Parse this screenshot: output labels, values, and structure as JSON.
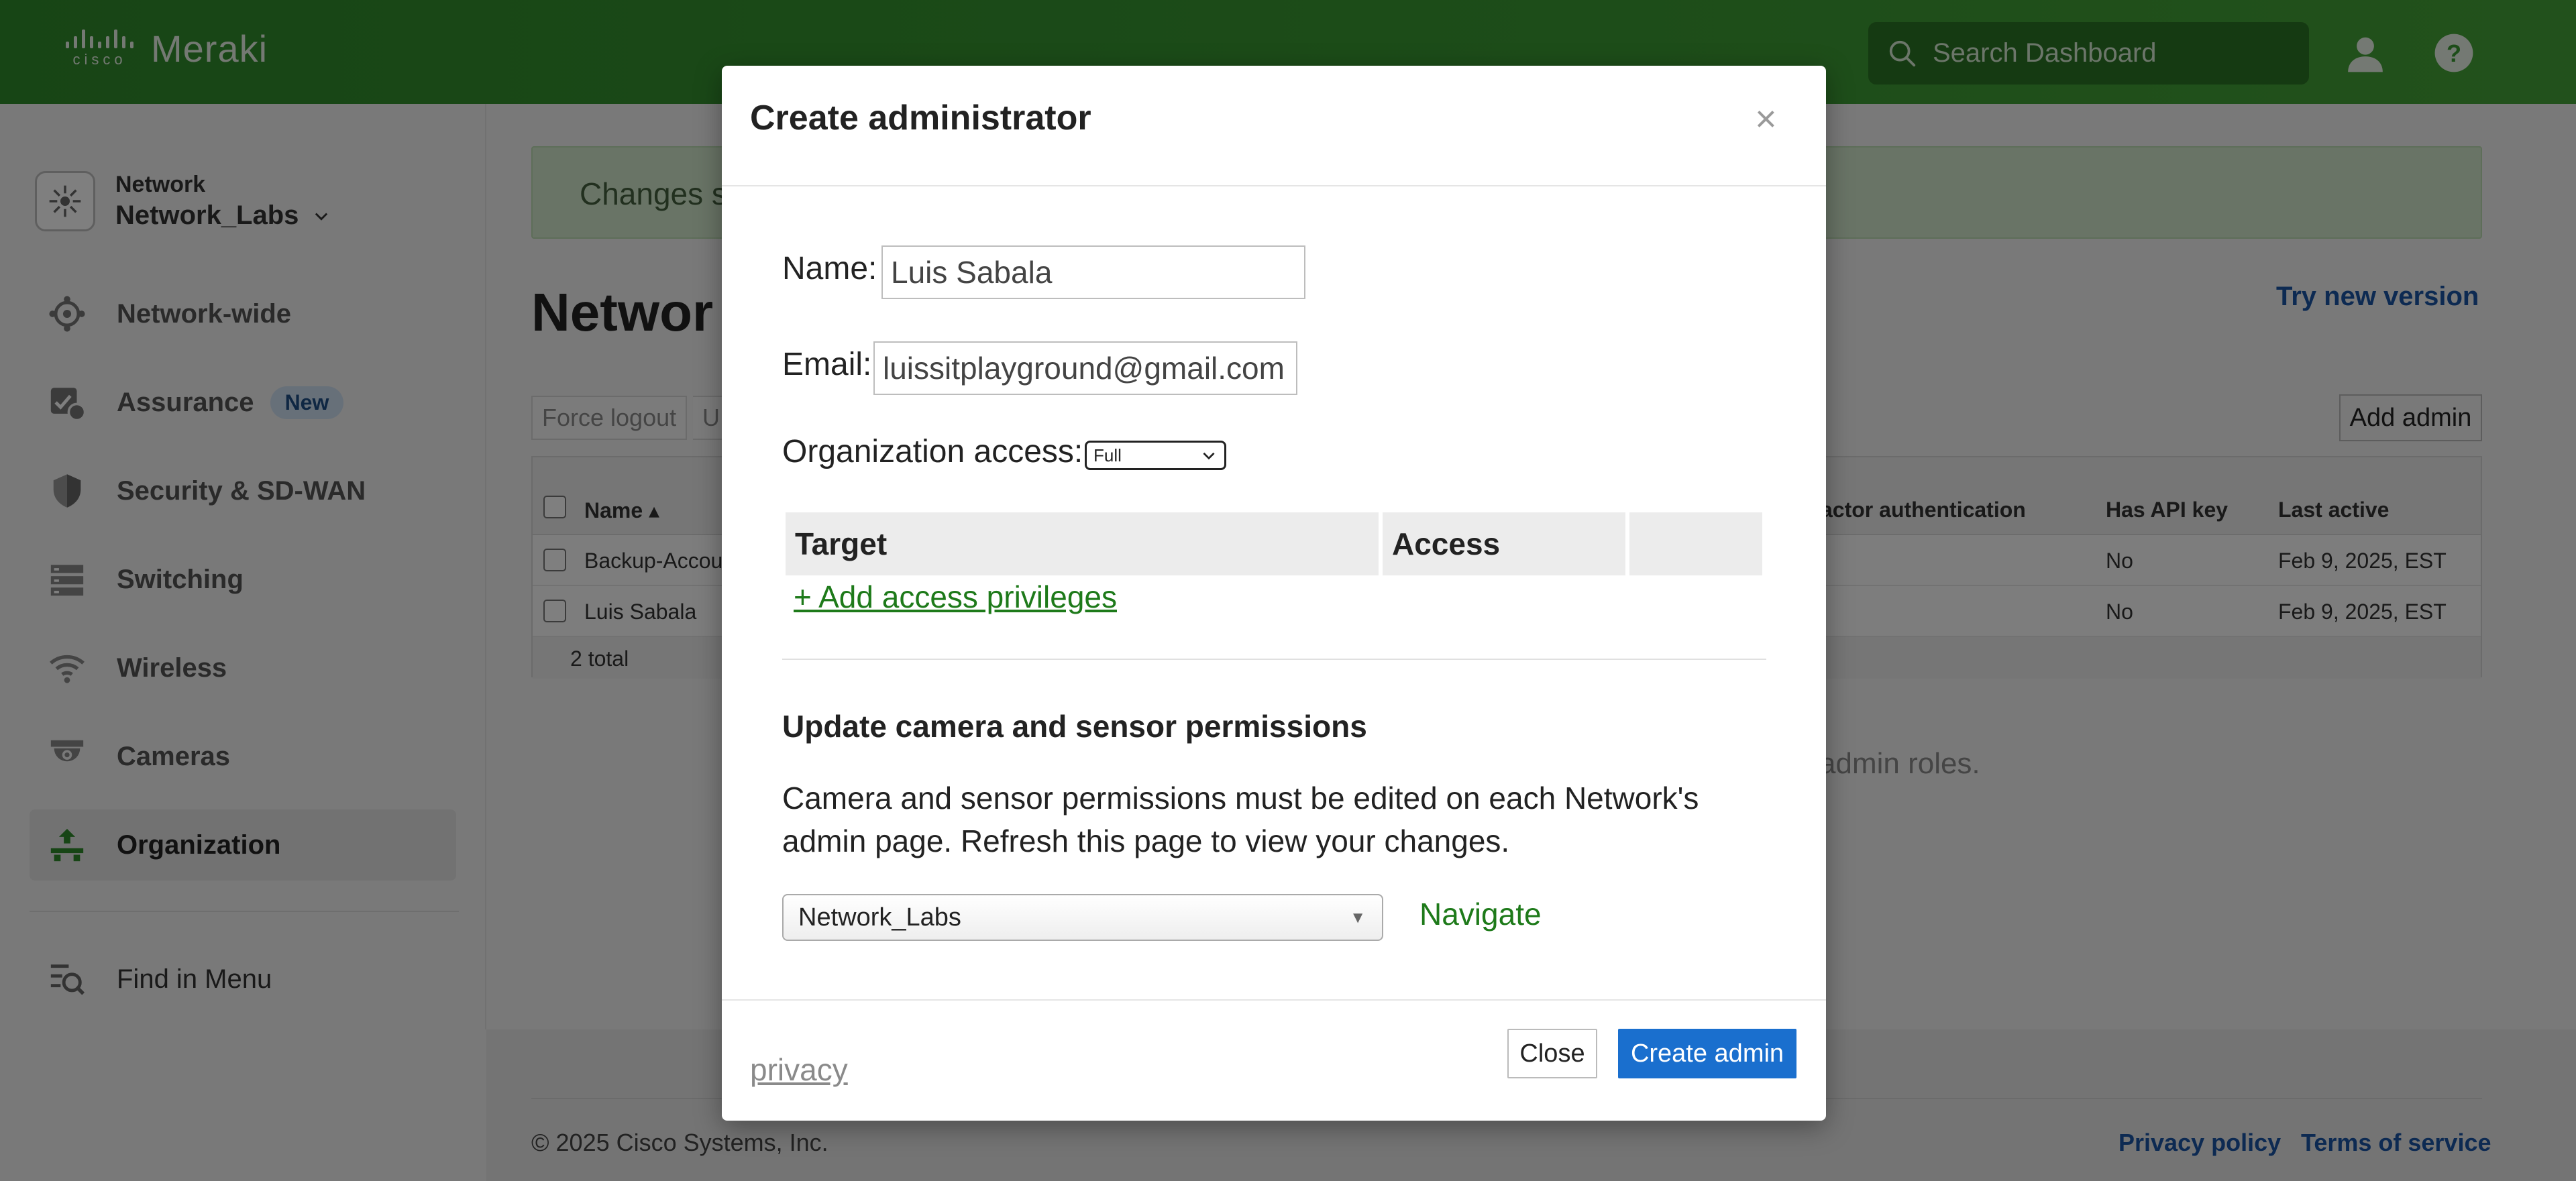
{
  "app": {
    "brand_small": "cisco",
    "brand_name": "Meraki",
    "search_placeholder": "Search Dashboard"
  },
  "sidebar": {
    "network_label": "Network",
    "network_name": "Network_Labs",
    "items": [
      {
        "label": "Network-wide",
        "icon": "network-wide-icon"
      },
      {
        "label": "Assurance",
        "icon": "assurance-icon",
        "badge": "New"
      },
      {
        "label": "Security & SD-WAN",
        "icon": "shield-icon"
      },
      {
        "label": "Switching",
        "icon": "switch-icon"
      },
      {
        "label": "Wireless",
        "icon": "wifi-icon"
      },
      {
        "label": "Cameras",
        "icon": "camera-icon"
      },
      {
        "label": "Organization",
        "icon": "organization-icon",
        "active": true
      }
    ],
    "find_in_menu": "Find in Menu"
  },
  "main": {
    "banner_text": "Changes s",
    "title_partial": "Networ",
    "try_new_version": "Try new version",
    "toolbar": {
      "force_logout": "Force logout",
      "next_partial": "U",
      "add_admin": "Add admin"
    },
    "table": {
      "columns": [
        "Name ▴",
        "actor authentication",
        "Has API key",
        "Last active"
      ],
      "rows": [
        {
          "name": "Backup-Accou",
          "api": "No",
          "last_active": "Feb 9, 2025, EST"
        },
        {
          "name": "Luis Sabala",
          "api": "No",
          "last_active": "Feb 9, 2025, EST"
        }
      ],
      "total": "2 total"
    },
    "admin_roles_partial": "admin roles."
  },
  "footer": {
    "copyright": "© 2025 Cisco Systems, Inc.",
    "privacy_policy": "Privacy policy",
    "terms": "Terms of service"
  },
  "modal": {
    "title": "Create administrator",
    "close_x": "×",
    "name_label": "Name:",
    "name_value": "Luis Sabala",
    "email_label": "Email:",
    "email_value": "luissitplayground@gmail.com",
    "org_access_label": "Organization access:",
    "org_access_value": "Full",
    "privileges_table": {
      "target_header": "Target",
      "access_header": "Access",
      "add_link": "+ Add access privileges"
    },
    "camera_section_title": "Update camera and sensor permissions",
    "camera_section_text": "Camera and sensor permissions must be edited on each Network's admin page. Refresh this page to view your changes.",
    "network_dropdown_value": "Network_Labs",
    "navigate": "Navigate",
    "privacy": "privacy",
    "close_button": "Close",
    "create_button": "Create admin"
  },
  "colors": {
    "header_green": "#3a9a32",
    "link_green": "#1e7a1a",
    "primary_blue": "#1a6fce",
    "link_blue": "#1a55a5"
  }
}
